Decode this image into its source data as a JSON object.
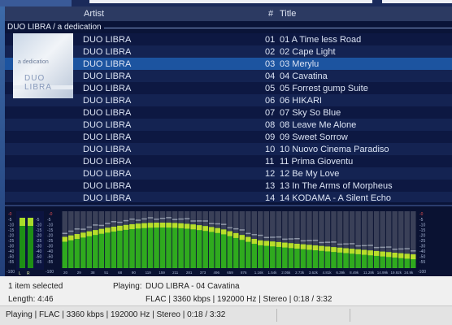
{
  "columns": {
    "artist": "Artist",
    "num": "#",
    "title": "Title"
  },
  "group": {
    "label": "DUO LIBRA / a dedication"
  },
  "tracks": [
    {
      "artist": "DUO LIBRA",
      "num": "01",
      "title": "01 A Time less Road"
    },
    {
      "artist": "DUO LIBRA",
      "num": "02",
      "title": "02 Cape Light"
    },
    {
      "artist": "DUO LIBRA",
      "num": "03",
      "title": "03 Merylu"
    },
    {
      "artist": "DUO LIBRA",
      "num": "04",
      "title": "04 Cavatina"
    },
    {
      "artist": "DUO LIBRA",
      "num": "05",
      "title": "05 Forrest gump Suite"
    },
    {
      "artist": "DUO LIBRA",
      "num": "06",
      "title": "06 HIKARI"
    },
    {
      "artist": "DUO LIBRA",
      "num": "07",
      "title": "07 Sky So Blue"
    },
    {
      "artist": "DUO LIBRA",
      "num": "08",
      "title": "08 Leave Me Alone"
    },
    {
      "artist": "DUO LIBRA",
      "num": "09",
      "title": "09 Sweet Sorrow"
    },
    {
      "artist": "DUO LIBRA",
      "num": "10",
      "title": "10 Nuovo Cinema Paradiso"
    },
    {
      "artist": "DUO LIBRA",
      "num": "11",
      "title": "11 Prima Gioventu"
    },
    {
      "artist": "DUO LIBRA",
      "num": "12",
      "title": "12 Be My Love"
    },
    {
      "artist": "DUO LIBRA",
      "num": "13",
      "title": "13 In The Arms of Morpheus"
    },
    {
      "artist": "DUO LIBRA",
      "num": "14",
      "title": "14 KODAMA - A Silent Echo"
    }
  ],
  "selected_index": 2,
  "album_art": {
    "line1": "a dedication",
    "line2": "DUO LIBRA"
  },
  "visualizer": {
    "peak_scale": [
      "-5",
      "-10",
      "-15",
      "-20",
      "-25",
      "-30",
      "-40",
      "-50",
      "-55"
    ],
    "peak_top": "-0",
    "peak_bottom": "-100",
    "channels": [
      "L",
      "R"
    ],
    "spectrum_scale": [
      "-5",
      "-10",
      "-15",
      "-20",
      "-25",
      "-30",
      "-40",
      "-50",
      "-55"
    ],
    "spectrum_top": "-0",
    "spectrum_bottom": "-100",
    "freq_labels": [
      "20",
      "29",
      "38",
      "51",
      "68",
      "90",
      "119",
      "159",
      "211",
      "281",
      "373",
      "496",
      "659",
      "876",
      "1.16k",
      "1.54k",
      "2.05k",
      "2.73k",
      "3.62k",
      "4.81k",
      "6.39k",
      "8.49k",
      "11.28k",
      "14.99k",
      "19.92k",
      "24.9k"
    ],
    "colors": {
      "bar_green": "#2faa1e",
      "bar_yellow": "#b8de2a",
      "bar_gray": "#3a4058",
      "peak": "#8f97a8"
    }
  },
  "status": {
    "selection": "1 item selected",
    "playing_label": "Playing:",
    "playing_value": "DUO LIBRA - 04 Cavatina",
    "length_label": "Length: 4:46",
    "format_info": "FLAC | 3360 kbps | 192000 Hz | Stereo | 0:18 / 3:32"
  },
  "statusbar": {
    "text": "Playing | FLAC | 3360 kbps | 192000 Hz | Stereo | 0:18 / 3:32"
  }
}
